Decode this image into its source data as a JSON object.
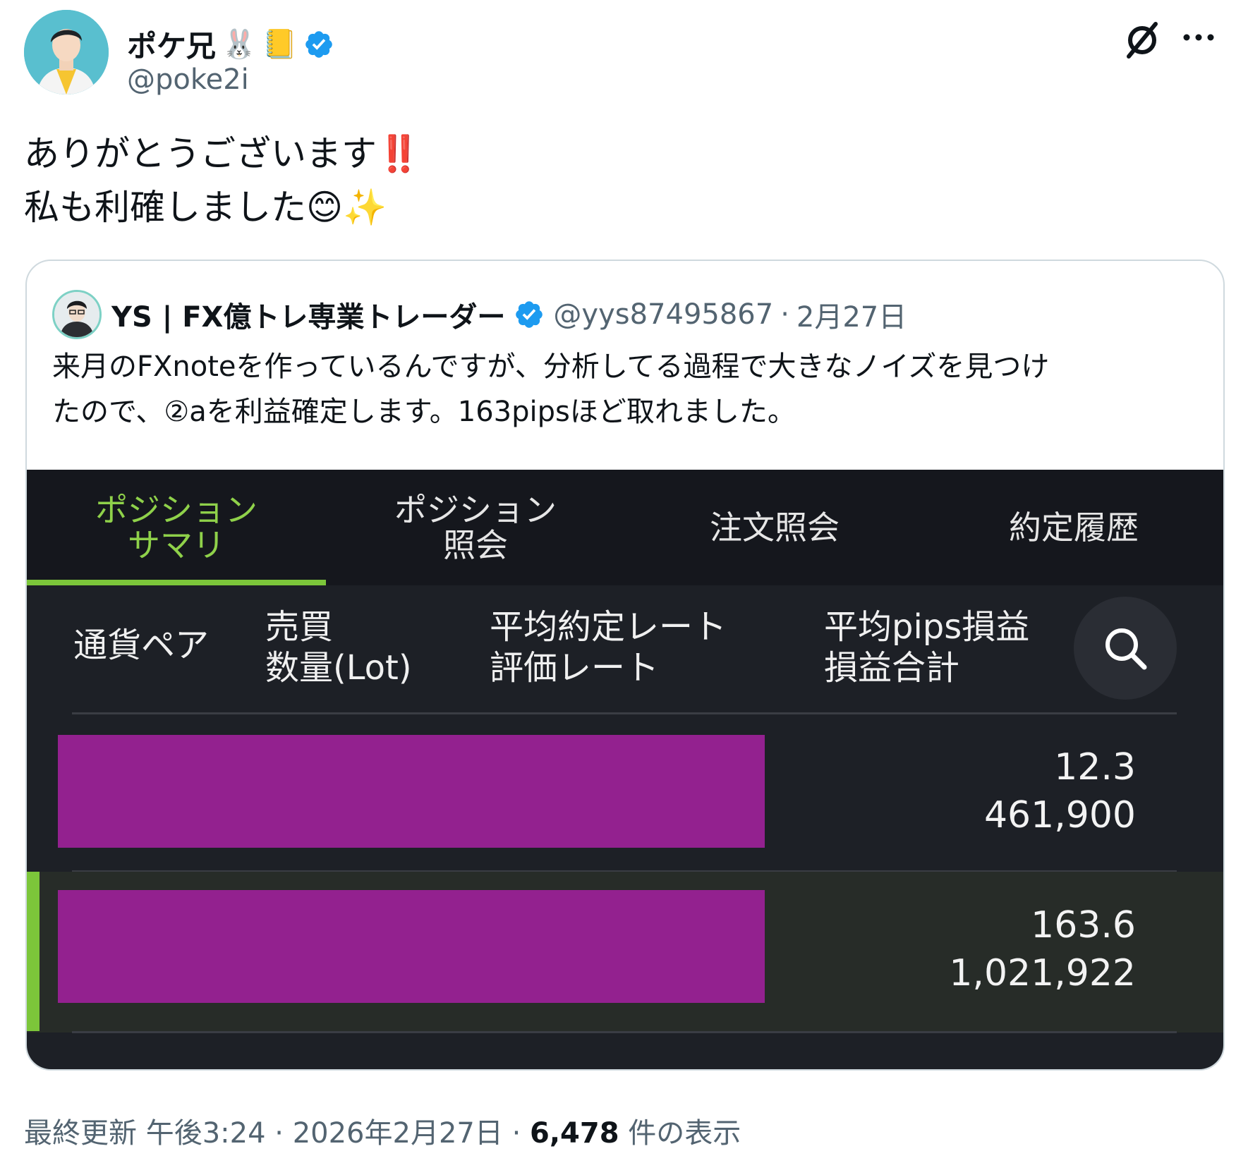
{
  "author": {
    "display_name": "ポケ兄",
    "name_emojis": [
      "🐰",
      "📒"
    ],
    "handle": "@poke2i",
    "verified": true
  },
  "tweet": {
    "line1": "ありがとうございます",
    "line1_emoji": "‼️",
    "line2": "私も利確しました",
    "line2_emojis": [
      "😊",
      "✨"
    ]
  },
  "quote": {
    "author_name": "YS | FX億トレ専業トレーダー",
    "handle": "@yys87495867",
    "separator": "·",
    "date": "2月27日",
    "text_line1": "来月のFXnoteを作っているんですが、分析してる過程で大きなノイズを見つけ",
    "text_line2": "たので、②aを利益確定します。163pipsほど取れました。",
    "app": {
      "tabs": [
        {
          "line1": "ポジション",
          "line2": "サマリ",
          "active": true
        },
        {
          "line1": "ポジション",
          "line2": "照会",
          "active": false
        },
        {
          "line1": "注文照会",
          "line2": "",
          "active": false
        },
        {
          "line1": "約定履歴",
          "line2": "",
          "active": false
        }
      ],
      "columns": {
        "pair": "通貨ペア",
        "side_line1": "売買",
        "side_line2": "数量(Lot)",
        "rate_line1": "平均約定レート",
        "rate_line2": "評価レート",
        "pips_line1": "平均pips損益",
        "pips_line2": "損益合計"
      },
      "rows": [
        {
          "pips": "12.3",
          "total": "461,900",
          "selected": false
        },
        {
          "pips": "163.6",
          "total": "1,021,922",
          "selected": true
        }
      ],
      "colors": {
        "accent": "#7cc63a",
        "redaction": "#93218f",
        "background": "#1d2026"
      }
    }
  },
  "footer": {
    "label": "最終更新",
    "time": "午後3:24",
    "date": "2026年2月27日",
    "views": "6,478",
    "views_label": "件の表示",
    "separator": "·"
  }
}
